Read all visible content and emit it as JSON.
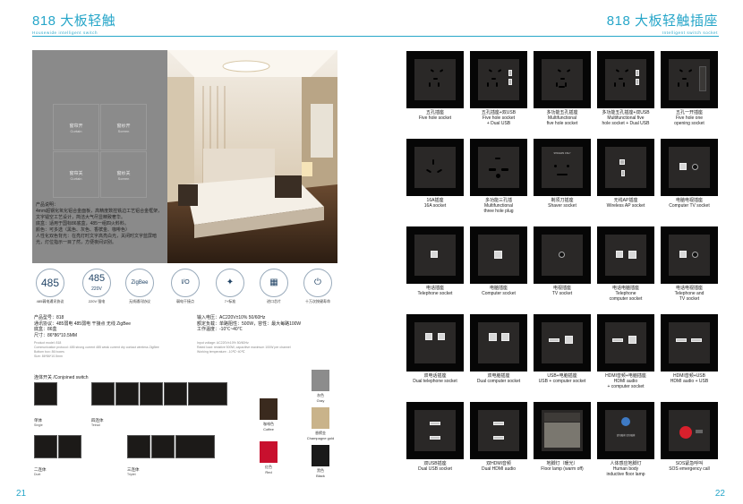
{
  "left_page": {
    "header": {
      "title": "818 大板轻触",
      "subtitle": "Housewide intelligent switch"
    },
    "page_number": "21",
    "switch_keys": [
      {
        "cn": "窗帘开",
        "en": "Curtain"
      },
      {
        "cn": "窗纱开",
        "en": "Screen"
      },
      {
        "cn": "窗帘关",
        "en": "Curtain"
      },
      {
        "cn": "窗纱关",
        "en": "Screen"
      }
    ],
    "description": "产品说明：\n4mm超钢化氧化铝合金面板，高精度数控铣边工艺铝合金框架，文字镭空工艺设计，简洁大气尽显精致奢华。\n底盒：适用于国标86底盒，485一组四火料料。\n颜色：可多选（黑色、灰色、香槟金、咖啡色）\n人性化双色背光：在亮灯时文字高亮白光，关闭时文字蓝屏暗光，灯位指示一目了然，方便夜间识别。",
    "features": [
      {
        "icon": "485-icon",
        "big": "485",
        "label": "485弱电通讯协议"
      },
      {
        "icon": "485-220v-icon",
        "big": "485",
        "sub": "220V",
        "label": "220V 强电"
      },
      {
        "icon": "zigbee-icon",
        "big": "ZigBee",
        "label": "无线通讯协议"
      },
      {
        "icon": "io-icon",
        "big": "I/O",
        "label": "弱电干接点"
      },
      {
        "icon": "nfc-icon",
        "big": "✦",
        "label": "7+标准"
      },
      {
        "icon": "chip-icon",
        "big": "▦",
        "label": "进口芯片"
      },
      {
        "icon": "power-icon",
        "big": "⏻",
        "label": "十万次按键寿命"
      }
    ],
    "specs_cn_left": [
      "产品型号：818",
      "通讯协议：485弱电  485弱电  干接点  无线  ZigBee",
      "底盒：86盒",
      "尺寸：86*86*10.5MM"
    ],
    "specs_en_left": [
      "Product model: 818",
      "Communication protocol: 485 strong current 485 weak current dry contact wireless ZigBee",
      "Bottom box: 86 boxes",
      "Size: 86*86*10.5mm"
    ],
    "specs_cn_right": [
      "输入电压：AC220V±10%  50/60Hz",
      "额定负载：单路阻性：500W，容性：最大每路100W",
      "工作温度：-10℃~40℃"
    ],
    "specs_en_right": [
      "Input voltage: AC220V±10% 50/60Hz",
      "Rated load: resistive 500W, capacitive maximum 100W per channel",
      "Working temperature: -10℃~40℃"
    ],
    "combo_title": "连体开关 /Conjoined switch",
    "combos": [
      {
        "cn": "单体",
        "en": "Single"
      },
      {
        "cn": "四连体",
        "en": "Tetrad"
      },
      {
        "cn": "二连体",
        "en": "Duet"
      },
      {
        "cn": "三连体",
        "en": "Triplet"
      }
    ],
    "swatches": [
      {
        "cn": "灰色",
        "en": "Gray",
        "color": "#8c8c8c"
      },
      {
        "cn": "咖啡色",
        "en": "Coffee",
        "color": "#3a2a1e"
      },
      {
        "cn": "香槟金",
        "en": "Champagne gold",
        "color": "#c9b38a"
      },
      {
        "cn": "红色",
        "en": "Red",
        "color": "#c8102e"
      },
      {
        "cn": "黑色",
        "en": "Black",
        "color": "#1a1a1a"
      }
    ]
  },
  "right_page": {
    "header": {
      "title": "818 大板轻触插座",
      "subtitle": "Intelligent switch socket"
    },
    "page_number": "22",
    "sockets": [
      {
        "cn": "五孔插座",
        "en": "Five hole socket",
        "kind": "five"
      },
      {
        "cn": "五孔插座+双USB",
        "en": "Five hole socket\n+ Dual USB",
        "kind": "five_usb"
      },
      {
        "cn": "多功能五孔插座",
        "en": "Multifunctional\nfive hole socket",
        "kind": "multi5"
      },
      {
        "cn": "多功能五孔插座+双USB",
        "en": "Multifunctional five\nhole socket + Dual USB",
        "kind": "multi5_usb"
      },
      {
        "cn": "五孔一开插座",
        "en": "Five hole one\nopening socket",
        "kind": "five_switch"
      },
      {
        "cn": "16A插座",
        "en": "16A socket",
        "kind": "16a"
      },
      {
        "cn": "多功能三孔插",
        "en": "Multifunctional\nthree hole plug",
        "kind": "multi3"
      },
      {
        "cn": "剃须刀插座",
        "en": "Shaver socket",
        "kind": "shaver"
      },
      {
        "cn": "无线AP插座",
        "en": "Wireless AP socket",
        "kind": "ap"
      },
      {
        "cn": "电脑电视插座",
        "en": "Computer TV socket",
        "kind": "comp_tv"
      },
      {
        "cn": "电话插座",
        "en": "Telephone socket",
        "kind": "tel"
      },
      {
        "cn": "电脑插座",
        "en": "Computer socket",
        "kind": "comp"
      },
      {
        "cn": "电视插座",
        "en": "TV socket",
        "kind": "tv"
      },
      {
        "cn": "电话电脑插座",
        "en": "Telephone\ncomputer socket",
        "kind": "tel_comp"
      },
      {
        "cn": "电话电视插座",
        "en": "Telephone and\nTV socket",
        "kind": "tel_tv"
      },
      {
        "cn": "双电话插座",
        "en": "Dual telephone socket",
        "kind": "dual_tel"
      },
      {
        "cn": "双电脑插座",
        "en": "Dual computer socket",
        "kind": "dual_comp"
      },
      {
        "cn": "USB+电脑插座",
        "en": "USB + computer socket",
        "kind": "usb_comp"
      },
      {
        "cn": "HDMI音频+电脑插座",
        "en": "HDMI audio\n+ computer socket",
        "kind": "hdmi_comp"
      },
      {
        "cn": "HDMI音频+USB",
        "en": "HDMI audio + USB",
        "kind": "hdmi_usb"
      },
      {
        "cn": "双USB插座",
        "en": "Dual USB socket",
        "kind": "dual_usb"
      },
      {
        "cn": "双HDMI音频",
        "en": "Dual HDMI audio",
        "kind": "dual_hdmi"
      },
      {
        "cn": "地脚灯（暖光）",
        "en": "Floor lamp (warm off)",
        "kind": "floor"
      },
      {
        "cn": "人体感应地脚灯",
        "en": "Human body\ninductive floor lamp",
        "kind": "human"
      },
      {
        "cn": "SOS紧急呼叫",
        "en": "SOS emergency call",
        "kind": "sos"
      }
    ],
    "shaver_text": "SHAVERS ONLY",
    "human_text": "请勿触摸 请勿触摸"
  }
}
